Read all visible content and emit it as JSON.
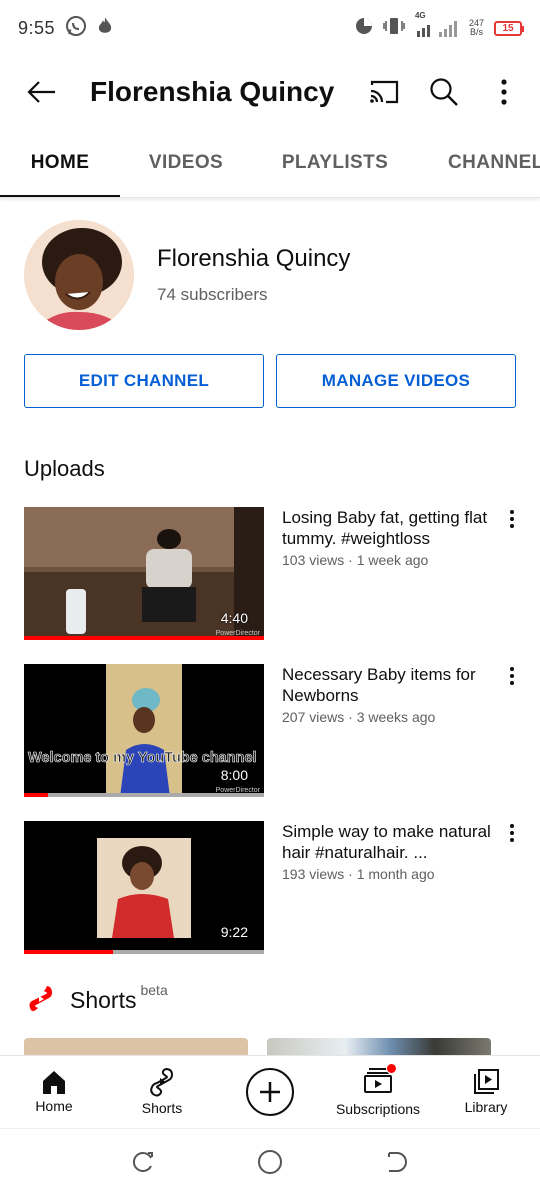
{
  "status_bar": {
    "time": "9:55",
    "network_type": "4G",
    "net_speed_value": "247",
    "net_speed_unit": "B/s",
    "battery_level": "15"
  },
  "app_bar": {
    "title": "Florenshia Quincy",
    "icons": [
      "back-arrow-icon",
      "cast-icon",
      "search-icon",
      "more-vertical-icon"
    ]
  },
  "tabs": [
    {
      "label": "HOME",
      "active": true
    },
    {
      "label": "VIDEOS",
      "active": false
    },
    {
      "label": "PLAYLISTS",
      "active": false
    },
    {
      "label": "CHANNEL",
      "active": false
    }
  ],
  "channel": {
    "name": "Florenshia Quincy",
    "subscribers": "74 subscribers"
  },
  "buttons": {
    "edit_channel": "EDIT CHANNEL",
    "manage_videos": "MANAGE VIDEOS"
  },
  "uploads": {
    "title": "Uploads",
    "videos": [
      {
        "title": "Losing Baby fat, getting flat tummy. #weightloss",
        "stats": "103 views · 1 week ago",
        "duration": "4:40",
        "watermark": "PowerDirector",
        "watched_fraction": 1.0
      },
      {
        "title": "Necessary Baby items for Newborns",
        "stats": "207 views · 3 weeks ago",
        "duration": "8:00",
        "overlay_text": "Welcome to my YouTube channel",
        "watermark": "PowerDirector",
        "watched_fraction": 0.1
      },
      {
        "title": "Simple way to make natural hair #naturalhair. ...",
        "stats": "193 views · 1 month ago",
        "duration": "9:22",
        "watched_fraction": 0.37
      }
    ]
  },
  "shorts": {
    "label": "Shorts",
    "badge": "beta"
  },
  "bottom_nav": [
    {
      "label": "Home",
      "icon": "home-icon"
    },
    {
      "label": "Shorts",
      "icon": "shorts-icon"
    },
    {
      "label": "",
      "icon": "create-plus-icon"
    },
    {
      "label": "Subscriptions",
      "icon": "subscriptions-icon",
      "has_notification_dot": true
    },
    {
      "label": "Library",
      "icon": "library-icon"
    }
  ],
  "colors": {
    "accent_blue": "#065fd4",
    "youtube_red": "#ff0000",
    "text_primary": "#0f0f0f",
    "text_secondary": "#606060"
  }
}
